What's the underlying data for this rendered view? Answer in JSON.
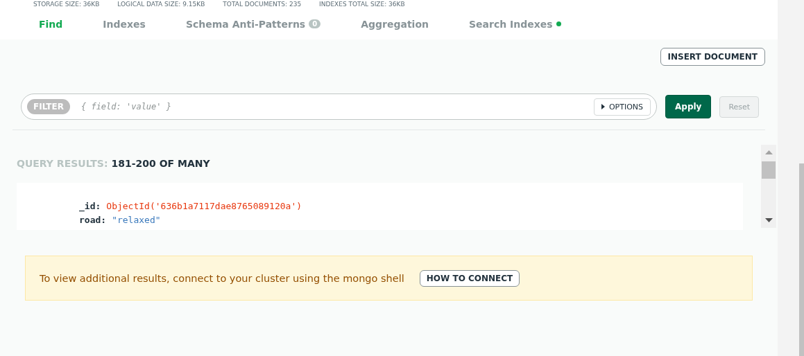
{
  "stats": [
    "STORAGE SIZE: 36KB",
    "LOGICAL DATA SIZE: 9.15KB",
    "TOTAL DOCUMENTS: 235",
    "INDEXES TOTAL SIZE: 36KB"
  ],
  "tabs": [
    {
      "label": "Find",
      "selected": true
    },
    {
      "label": "Indexes",
      "selected": false
    },
    {
      "label": "Schema Anti-Patterns",
      "selected": false,
      "badge": "0"
    },
    {
      "label": "Aggregation",
      "selected": false
    },
    {
      "label": "Search Indexes",
      "selected": false,
      "color": "#13aa52"
    }
  ],
  "insert_button": "INSERT DOCUMENT",
  "filter": {
    "label": "FILTER",
    "placeholder": "{ field: 'value' }",
    "options": "OPTIONS"
  },
  "apply_button": "Apply",
  "reset_button": {
    "label": "Reset",
    "disabled": true
  },
  "query_results": {
    "label": "QUERY RESULTS:",
    "value": "181-200 OF MANY"
  },
  "document": [
    {
      "key": "_id:",
      "value": "ObjectId('636b1a7117dae8765089120a')",
      "kind": "objectid"
    },
    {
      "key": "road:",
      "value": "\"relaxed\"",
      "kind": "string"
    }
  ],
  "banner": {
    "text": "To view additional results, connect to your cluster using the mongo shell",
    "button": "HOW TO CONNECT"
  }
}
